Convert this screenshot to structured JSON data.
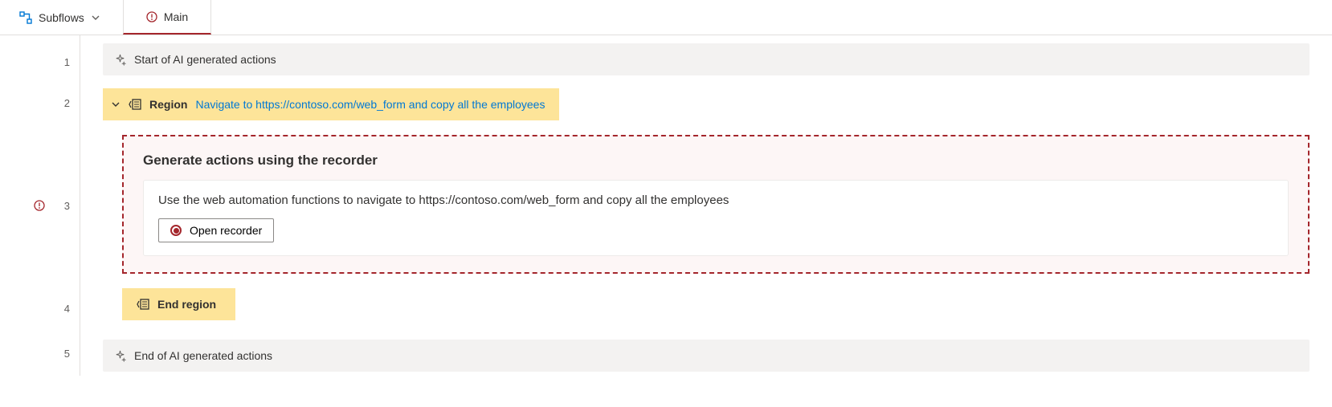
{
  "tabs": {
    "subflows_label": "Subflows",
    "main_label": "Main"
  },
  "gutter": {
    "line1": "1",
    "line2": "2",
    "line3": "3",
    "line4": "4",
    "line5": "5"
  },
  "actions": {
    "start_ai": "Start of AI generated actions",
    "end_ai": "End of AI generated actions",
    "region_label": "Region",
    "region_desc": "Navigate to https://contoso.com/web_form and copy all the employees",
    "end_region_label": "End region"
  },
  "recorder": {
    "title": "Generate actions using the recorder",
    "description": "Use the web automation functions to navigate to https://contoso.com/web_form and copy all the employees",
    "button_label": "Open recorder"
  }
}
